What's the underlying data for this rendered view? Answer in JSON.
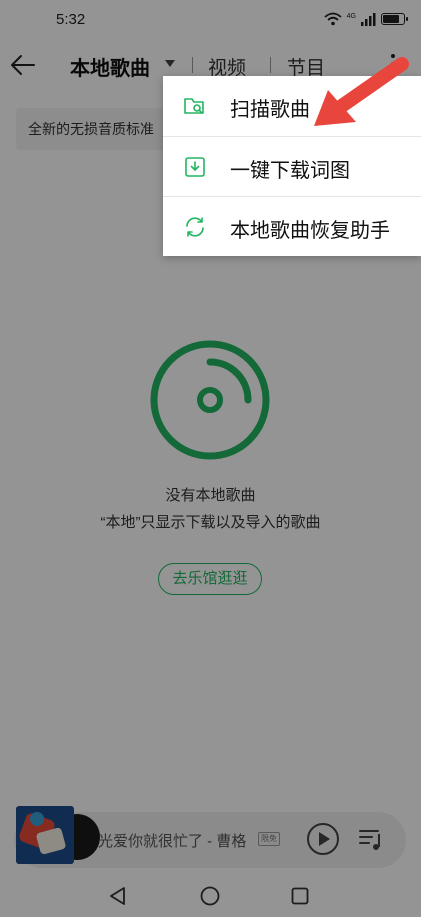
{
  "status_bar": {
    "time": "5:32",
    "network": "4G",
    "battery_level": 0.85
  },
  "nav": {
    "tabs": [
      {
        "label": "本地歌曲"
      },
      {
        "label": "视频"
      },
      {
        "label": "节目"
      }
    ]
  },
  "banner": {
    "text": "全新的无损音质标准"
  },
  "empty_state": {
    "title": "没有本地歌曲",
    "description": "“本地”只显示下载以及导入的歌曲",
    "button_label": "去乐馆逛逛"
  },
  "mini_player": {
    "song": "光爱你就很忙了 - 曹格",
    "tag": "限免"
  },
  "menu": {
    "items": [
      {
        "label": "扫描歌曲",
        "icon": "folder-search-icon"
      },
      {
        "label": "一键下载词图",
        "icon": "download-box-icon"
      },
      {
        "label": "本地歌曲恢复助手",
        "icon": "sync-icon"
      }
    ]
  },
  "colors": {
    "accent": "#22b560",
    "annotation": "#e8453c"
  }
}
